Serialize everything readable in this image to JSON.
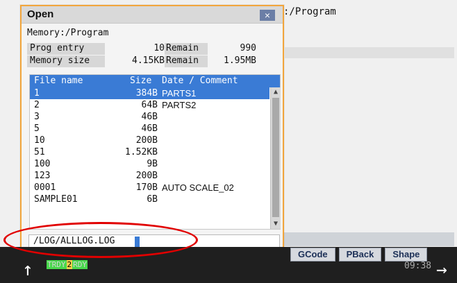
{
  "background": {
    "path_text": ":/Program"
  },
  "dialog": {
    "title": "Open",
    "close_glyph": "×",
    "memory_label": "Memory:/Program",
    "summary": {
      "row1": {
        "label1": "Prog entry",
        "value1": "10",
        "label2": "Remain",
        "value2": "990"
      },
      "row2": {
        "label1": "Memory size",
        "value1": "4.15KB",
        "label2": "Remain",
        "value2": "1.95MB"
      }
    },
    "table": {
      "headers": {
        "name": "File name",
        "size": "Size",
        "date_comment": "Date / Comment"
      },
      "rows": [
        {
          "name": "1",
          "size": "384B",
          "comment": "PARTS1",
          "selected": true
        },
        {
          "name": "2",
          "size": "64B",
          "comment": "PARTS2"
        },
        {
          "name": "3",
          "size": "46B",
          "comment": ""
        },
        {
          "name": "5",
          "size": "46B",
          "comment": ""
        },
        {
          "name": "10",
          "size": "200B",
          "comment": ""
        },
        {
          "name": "51",
          "size": "1.52KB",
          "comment": ""
        },
        {
          "name": "100",
          "size": "9B",
          "comment": ""
        },
        {
          "name": "123",
          "size": "200B",
          "comment": ""
        },
        {
          "name": "0001",
          "size": "170B",
          "comment": "AUTO SCALE_02"
        },
        {
          "name": "SAMPLE01",
          "size": "6B",
          "comment": ""
        }
      ]
    },
    "input": {
      "value": "/LOG/ALLLOG.LOG"
    }
  },
  "softkeys": [
    "GCode",
    "PBack",
    "Shape"
  ],
  "status": {
    "t1": "TRDY",
    "n": "2",
    "t2": "RDY"
  },
  "clock": "09:38",
  "icons": {
    "up_arrow": "↑",
    "right_arrow": "→",
    "scroll_up": "▲",
    "scroll_down": "▼"
  },
  "colors": {
    "accent": "#3a7bd5",
    "dialog_border": "#f2a53b",
    "annotation": "#e10000"
  }
}
